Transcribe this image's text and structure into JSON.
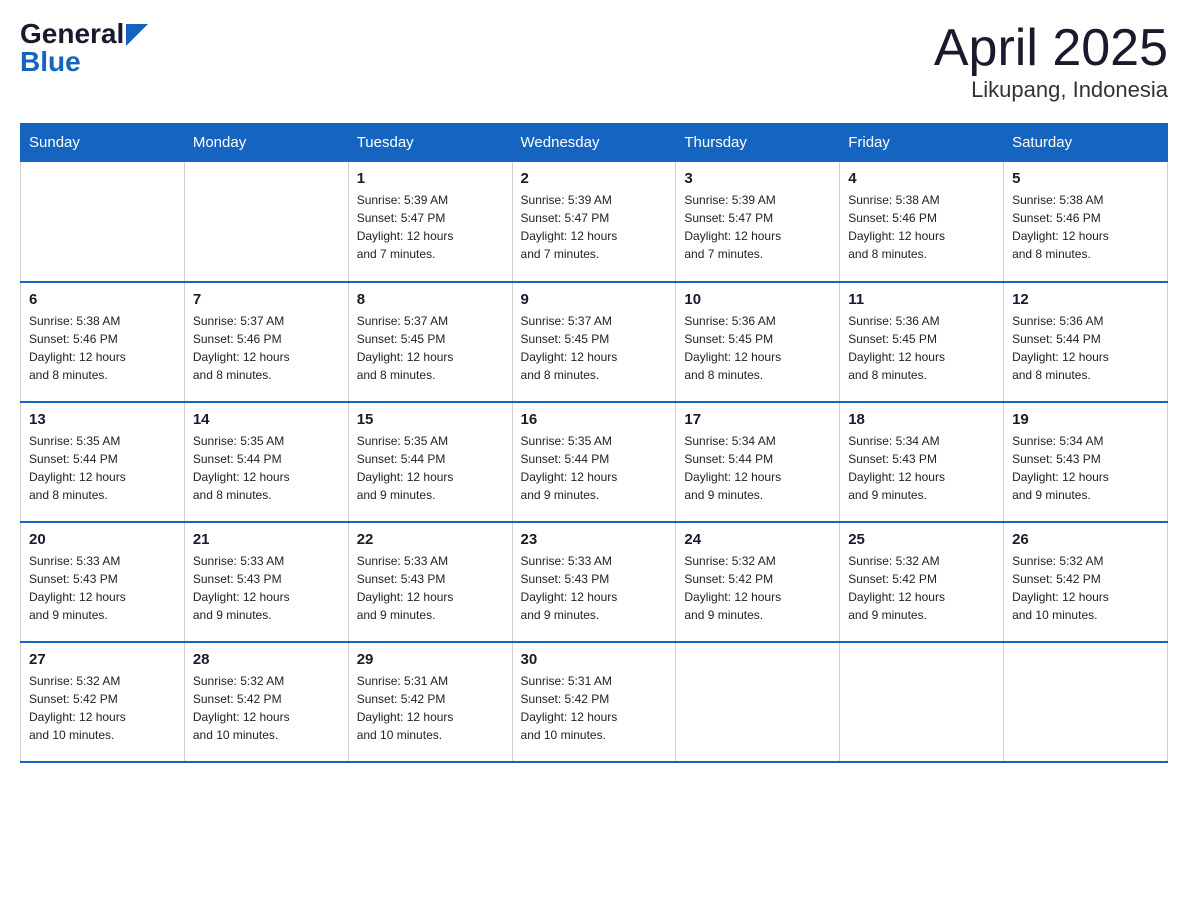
{
  "header": {
    "logo_general": "General",
    "logo_blue": "Blue",
    "title": "April 2025",
    "subtitle": "Likupang, Indonesia"
  },
  "days_of_week": [
    "Sunday",
    "Monday",
    "Tuesday",
    "Wednesday",
    "Thursday",
    "Friday",
    "Saturday"
  ],
  "weeks": [
    [
      {
        "day": "",
        "info": ""
      },
      {
        "day": "",
        "info": ""
      },
      {
        "day": "1",
        "info": "Sunrise: 5:39 AM\nSunset: 5:47 PM\nDaylight: 12 hours\nand 7 minutes."
      },
      {
        "day": "2",
        "info": "Sunrise: 5:39 AM\nSunset: 5:47 PM\nDaylight: 12 hours\nand 7 minutes."
      },
      {
        "day": "3",
        "info": "Sunrise: 5:39 AM\nSunset: 5:47 PM\nDaylight: 12 hours\nand 7 minutes."
      },
      {
        "day": "4",
        "info": "Sunrise: 5:38 AM\nSunset: 5:46 PM\nDaylight: 12 hours\nand 8 minutes."
      },
      {
        "day": "5",
        "info": "Sunrise: 5:38 AM\nSunset: 5:46 PM\nDaylight: 12 hours\nand 8 minutes."
      }
    ],
    [
      {
        "day": "6",
        "info": "Sunrise: 5:38 AM\nSunset: 5:46 PM\nDaylight: 12 hours\nand 8 minutes."
      },
      {
        "day": "7",
        "info": "Sunrise: 5:37 AM\nSunset: 5:46 PM\nDaylight: 12 hours\nand 8 minutes."
      },
      {
        "day": "8",
        "info": "Sunrise: 5:37 AM\nSunset: 5:45 PM\nDaylight: 12 hours\nand 8 minutes."
      },
      {
        "day": "9",
        "info": "Sunrise: 5:37 AM\nSunset: 5:45 PM\nDaylight: 12 hours\nand 8 minutes."
      },
      {
        "day": "10",
        "info": "Sunrise: 5:36 AM\nSunset: 5:45 PM\nDaylight: 12 hours\nand 8 minutes."
      },
      {
        "day": "11",
        "info": "Sunrise: 5:36 AM\nSunset: 5:45 PM\nDaylight: 12 hours\nand 8 minutes."
      },
      {
        "day": "12",
        "info": "Sunrise: 5:36 AM\nSunset: 5:44 PM\nDaylight: 12 hours\nand 8 minutes."
      }
    ],
    [
      {
        "day": "13",
        "info": "Sunrise: 5:35 AM\nSunset: 5:44 PM\nDaylight: 12 hours\nand 8 minutes."
      },
      {
        "day": "14",
        "info": "Sunrise: 5:35 AM\nSunset: 5:44 PM\nDaylight: 12 hours\nand 8 minutes."
      },
      {
        "day": "15",
        "info": "Sunrise: 5:35 AM\nSunset: 5:44 PM\nDaylight: 12 hours\nand 9 minutes."
      },
      {
        "day": "16",
        "info": "Sunrise: 5:35 AM\nSunset: 5:44 PM\nDaylight: 12 hours\nand 9 minutes."
      },
      {
        "day": "17",
        "info": "Sunrise: 5:34 AM\nSunset: 5:44 PM\nDaylight: 12 hours\nand 9 minutes."
      },
      {
        "day": "18",
        "info": "Sunrise: 5:34 AM\nSunset: 5:43 PM\nDaylight: 12 hours\nand 9 minutes."
      },
      {
        "day": "19",
        "info": "Sunrise: 5:34 AM\nSunset: 5:43 PM\nDaylight: 12 hours\nand 9 minutes."
      }
    ],
    [
      {
        "day": "20",
        "info": "Sunrise: 5:33 AM\nSunset: 5:43 PM\nDaylight: 12 hours\nand 9 minutes."
      },
      {
        "day": "21",
        "info": "Sunrise: 5:33 AM\nSunset: 5:43 PM\nDaylight: 12 hours\nand 9 minutes."
      },
      {
        "day": "22",
        "info": "Sunrise: 5:33 AM\nSunset: 5:43 PM\nDaylight: 12 hours\nand 9 minutes."
      },
      {
        "day": "23",
        "info": "Sunrise: 5:33 AM\nSunset: 5:43 PM\nDaylight: 12 hours\nand 9 minutes."
      },
      {
        "day": "24",
        "info": "Sunrise: 5:32 AM\nSunset: 5:42 PM\nDaylight: 12 hours\nand 9 minutes."
      },
      {
        "day": "25",
        "info": "Sunrise: 5:32 AM\nSunset: 5:42 PM\nDaylight: 12 hours\nand 9 minutes."
      },
      {
        "day": "26",
        "info": "Sunrise: 5:32 AM\nSunset: 5:42 PM\nDaylight: 12 hours\nand 10 minutes."
      }
    ],
    [
      {
        "day": "27",
        "info": "Sunrise: 5:32 AM\nSunset: 5:42 PM\nDaylight: 12 hours\nand 10 minutes."
      },
      {
        "day": "28",
        "info": "Sunrise: 5:32 AM\nSunset: 5:42 PM\nDaylight: 12 hours\nand 10 minutes."
      },
      {
        "day": "29",
        "info": "Sunrise: 5:31 AM\nSunset: 5:42 PM\nDaylight: 12 hours\nand 10 minutes."
      },
      {
        "day": "30",
        "info": "Sunrise: 5:31 AM\nSunset: 5:42 PM\nDaylight: 12 hours\nand 10 minutes."
      },
      {
        "day": "",
        "info": ""
      },
      {
        "day": "",
        "info": ""
      },
      {
        "day": "",
        "info": ""
      }
    ]
  ]
}
